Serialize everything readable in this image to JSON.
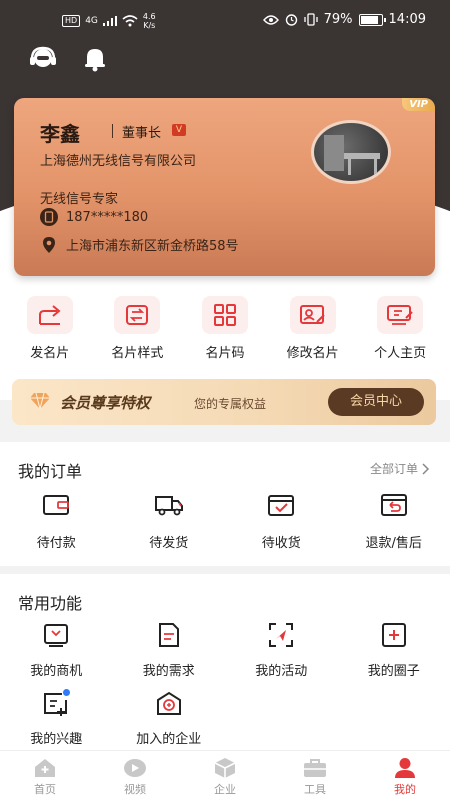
{
  "status_bar": {
    "hd": "HD",
    "signal": "4G",
    "speed_value": "4.6",
    "speed_unit": "K/s",
    "battery": "79%",
    "time": "14:09"
  },
  "colors": {
    "accent": "#e5383b",
    "card_gradient_start": "#eea67e",
    "card_gradient_end": "#c97a55",
    "header_bg": "#3a3433",
    "vip_button": "#5a3a22"
  },
  "header": {
    "icons": [
      "customer-service-icon",
      "bell-icon"
    ]
  },
  "card": {
    "vip_tag": "VIP",
    "name": "李鑫",
    "role": "董事长",
    "role_badge": "V",
    "company": "上海德州无线信号有限公司",
    "title": "无线信号专家",
    "phone": "187*****180",
    "address": "上海市浦东新区新金桥路58号"
  },
  "actions": [
    {
      "label": "发名片",
      "icon": "share-icon"
    },
    {
      "label": "名片样式",
      "icon": "swap-icon"
    },
    {
      "label": "名片码",
      "icon": "qrcode-icon"
    },
    {
      "label": "修改名片",
      "icon": "edit-card-icon"
    },
    {
      "label": "个人主页",
      "icon": "homepage-icon"
    }
  ],
  "vip_banner": {
    "title": "会员尊享特权",
    "subtitle": "您的专属权益",
    "button": "会员中心"
  },
  "orders": {
    "title": "我的订单",
    "all_link": "全部订单",
    "items": [
      {
        "label": "待付款",
        "icon": "wallet-icon"
      },
      {
        "label": "待发货",
        "icon": "truck-icon"
      },
      {
        "label": "待收货",
        "icon": "package-check-icon"
      },
      {
        "label": "退款/售后",
        "icon": "refund-icon"
      }
    ]
  },
  "features": {
    "title": "常用功能",
    "items": [
      {
        "label": "我的商机",
        "icon": "opportunity-icon"
      },
      {
        "label": "我的需求",
        "icon": "request-icon"
      },
      {
        "label": "我的活动",
        "icon": "activity-icon"
      },
      {
        "label": "我的圈子",
        "icon": "circle-icon"
      },
      {
        "label": "我的兴趣",
        "icon": "interest-icon"
      },
      {
        "label": "加入的企业",
        "icon": "enterprise-icon"
      }
    ]
  },
  "tabbar": [
    {
      "label": "首页",
      "icon": "home-icon",
      "active": false
    },
    {
      "label": "视频",
      "icon": "video-icon",
      "active": false
    },
    {
      "label": "企业",
      "icon": "cube-icon",
      "active": false
    },
    {
      "label": "工具",
      "icon": "toolbox-icon",
      "active": false
    },
    {
      "label": "我的",
      "icon": "profile-icon",
      "active": true
    }
  ]
}
